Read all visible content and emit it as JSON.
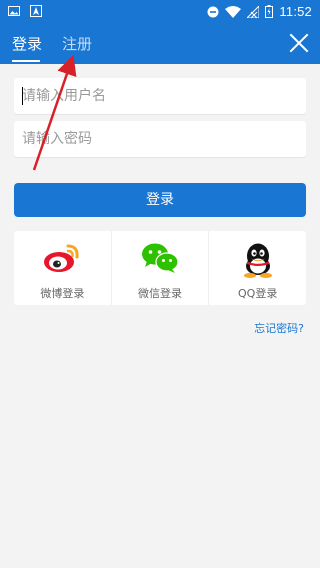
{
  "status_bar": {
    "time": "11:52",
    "icons": [
      "image-icon",
      "navigation-icon",
      "dnd-icon",
      "wifi-icon",
      "no-signal-icon",
      "battery-icon"
    ]
  },
  "header": {
    "tabs": [
      {
        "label": "登录",
        "active": true
      },
      {
        "label": "注册",
        "active": false
      }
    ],
    "close_icon": "close-icon"
  },
  "form": {
    "username_placeholder": "请输入用户名",
    "password_placeholder": "请输入密码",
    "login_button": "登录"
  },
  "social_login": [
    {
      "label": "微博登录",
      "icon": "weibo-icon"
    },
    {
      "label": "微信登录",
      "icon": "wechat-icon"
    },
    {
      "label": "QQ登录",
      "icon": "qq-icon"
    }
  ],
  "forgot_password": "忘记密码?",
  "colors": {
    "primary": "#1976d2",
    "annotation_arrow": "#d8202a"
  }
}
